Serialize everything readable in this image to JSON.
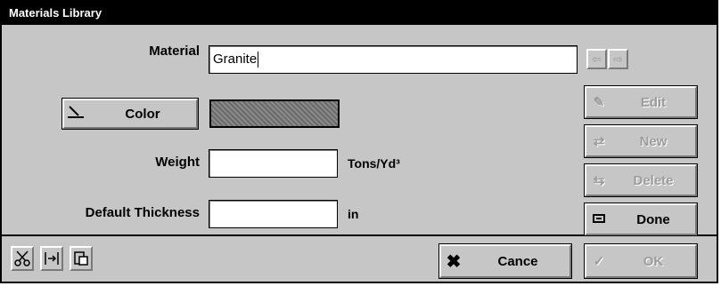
{
  "window": {
    "title": "Materials Library"
  },
  "form": {
    "material_label": "Material",
    "material_value": "Granite",
    "color_button_label": "Color",
    "weight_label": "Weight",
    "weight_value": "",
    "weight_unit": "Tons/Yd³",
    "thickness_label": "Default Thickness",
    "thickness_value": "",
    "thickness_unit": "in",
    "swatch_color": "#7a7a7a"
  },
  "side_buttons": {
    "edit_label": "Edit",
    "new_label": "New",
    "delete_label": "Delete",
    "done_label": "Done"
  },
  "footer": {
    "cancel_label": "Cance",
    "ok_label": "OK"
  },
  "icons": {
    "prev": "arrow-left-icon",
    "next": "arrow-right-icon",
    "cut": "scissors-icon",
    "split": "split-icon",
    "paste": "paste-icon"
  }
}
